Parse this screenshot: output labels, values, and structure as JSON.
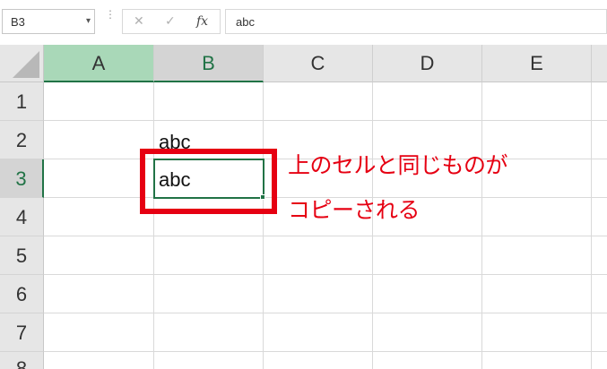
{
  "formula_bar": {
    "name_box": "B3",
    "name_box_arrow": "▾",
    "options_dots": "⋮",
    "cancel_glyph": "✕",
    "enter_glyph": "✓",
    "fx_glyph": "fx",
    "formula_value": "abc"
  },
  "columns": [
    "A",
    "B",
    "C",
    "D",
    "E"
  ],
  "rows": [
    "1",
    "2",
    "3",
    "4",
    "5",
    "6",
    "7",
    "8"
  ],
  "selection": {
    "column": "B",
    "row": "3"
  },
  "cells": {
    "B2": "abc",
    "B3": "abc"
  },
  "annotation": {
    "line1": "上のセルと同じものが",
    "line2": "コピーされる",
    "color": "#e60012"
  },
  "colors": {
    "accent": "#217346",
    "header_bg": "#e6e6e6",
    "selected_col_header_bg": "#a9d8b8"
  }
}
